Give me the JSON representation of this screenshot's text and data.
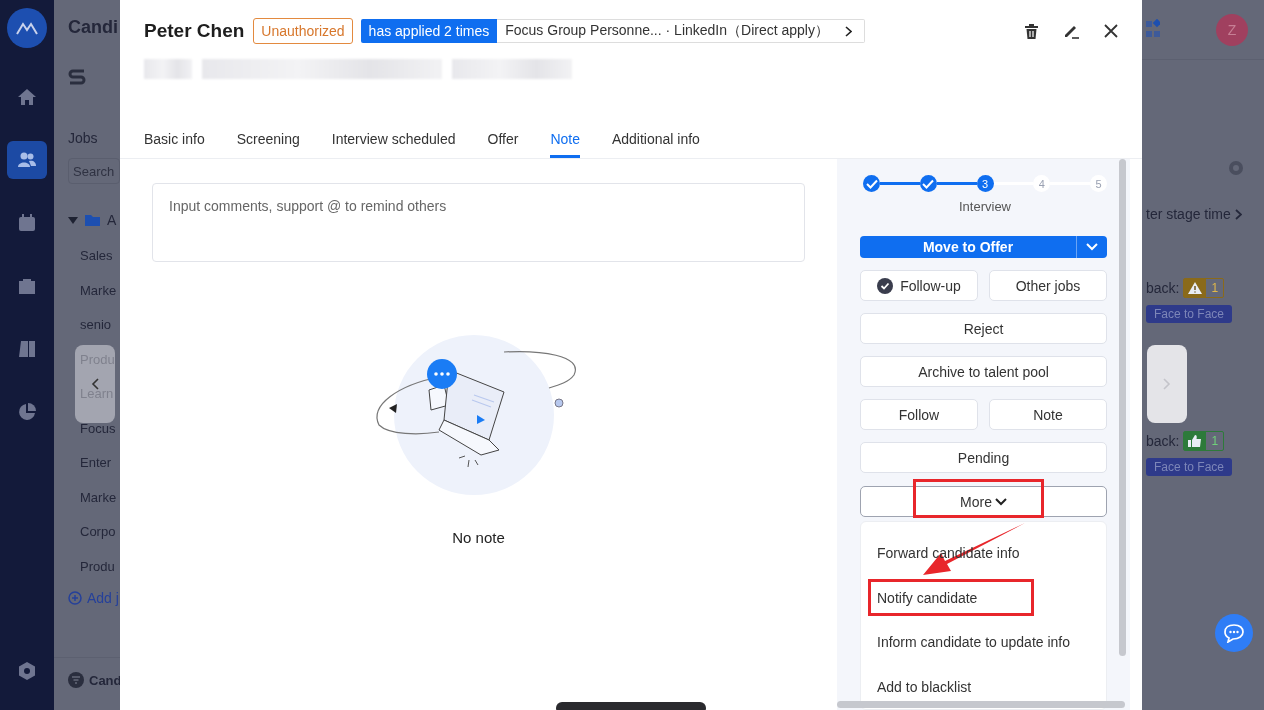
{
  "background": {
    "title": "Candi",
    "jobs_label": "Jobs",
    "search_placeholder": "Search",
    "folder": "A",
    "jobs": [
      "Sales",
      "Marke",
      "senio",
      "Produ",
      "Learn",
      "Focus",
      "Enter",
      "Marke",
      "Corpo",
      "Produ"
    ],
    "add_job": "Add j",
    "footer": "Cand",
    "avatar": "Z",
    "sort": "ter stage time",
    "feedback": [
      {
        "label": "back:",
        "kind": "warning",
        "count": "1",
        "tag": "Face to Face"
      },
      {
        "label": "back:",
        "kind": "like",
        "count": "1",
        "tag": "Face to Face"
      }
    ]
  },
  "nav": [
    {
      "kind": "home",
      "selected": false
    },
    {
      "kind": "people",
      "selected": true
    },
    {
      "kind": "calendar",
      "selected": false
    },
    {
      "kind": "bag",
      "selected": false
    },
    {
      "kind": "book",
      "selected": false
    },
    {
      "kind": "chart",
      "selected": false
    }
  ],
  "candidate": {
    "name": "Peter Chen",
    "status": "Unauthorized",
    "applied": "has applied 2 times",
    "source": "Focus Group Personne... · LinkedIn（Direct apply）"
  },
  "tabs": [
    {
      "label": "Basic info",
      "selected": false
    },
    {
      "label": "Screening",
      "selected": false
    },
    {
      "label": "Interview scheduled",
      "selected": false
    },
    {
      "label": "Offer",
      "selected": false
    },
    {
      "label": "Note",
      "selected": true
    },
    {
      "label": "Additional info",
      "selected": false
    }
  ],
  "note": {
    "placeholder": "Input comments, support @ to remind others",
    "empty": "No note"
  },
  "steps": [
    {
      "done": true,
      "current": false
    },
    {
      "done": true,
      "current": false
    },
    {
      "done": false,
      "current": true,
      "number": "3"
    },
    {
      "done": false,
      "current": false,
      "number": "4"
    },
    {
      "done": false,
      "current": false,
      "number": "5"
    }
  ],
  "step_label": "Interview",
  "primary": "Move to Offer",
  "action_rows": [
    [
      {
        "label": "Follow-up",
        "kind": "check"
      },
      {
        "label": "Other jobs",
        "kind": "plain"
      }
    ],
    [
      {
        "label": "Reject",
        "kind": "plain"
      }
    ],
    [
      {
        "label": "Archive to talent pool",
        "kind": "plain"
      }
    ],
    [
      {
        "label": "Follow",
        "kind": "plain"
      },
      {
        "label": "Note",
        "kind": "plain"
      }
    ],
    [
      {
        "label": "Pending",
        "kind": "plain"
      }
    ]
  ],
  "more": {
    "label": "More",
    "highlighted": true
  },
  "menu": [
    {
      "label": "Forward candidate info",
      "highlighted": false
    },
    {
      "label": "Notify candidate",
      "highlighted": true
    },
    {
      "label": "Inform candidate to update info",
      "highlighted": false
    },
    {
      "label": "Add to blacklist",
      "highlighted": false
    }
  ]
}
